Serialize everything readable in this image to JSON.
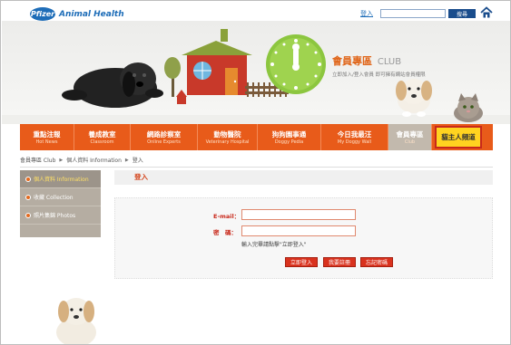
{
  "header": {
    "logo_mark": "Pfizer",
    "logo_text": "Animal Health",
    "login_link": "登入",
    "search_button": "搜尋"
  },
  "banner": {
    "club_title": "會員專區",
    "club_title_en": "CLUB",
    "club_subtitle": "立即加入/登入會員 即可擁有網站會員權限"
  },
  "nav": [
    {
      "zh": "重點注報",
      "en": "Hot News"
    },
    {
      "zh": "養成教室",
      "en": "Classroom"
    },
    {
      "zh": "網路診察室",
      "en": "Online Experts"
    },
    {
      "zh": "動物醫院",
      "en": "Veterinary Hospital"
    },
    {
      "zh": "狗狗園事通",
      "en": "Doggy Pedia"
    },
    {
      "zh": "今日我最汪",
      "en": "My Doggy Wall"
    },
    {
      "zh": "會員專區",
      "en": "Club"
    },
    {
      "zh": "貓主人頻道",
      "en": ""
    }
  ],
  "breadcrumb": {
    "c1": "會員專區 Club",
    "c2": "個人資料 Information",
    "c3": "登入"
  },
  "sidebar": [
    {
      "label": "個人資料 Information"
    },
    {
      "label": "收藏 Collection"
    },
    {
      "label": "照片集錦 Photos"
    }
  ],
  "main": {
    "title": "登入",
    "email_label": "E-mail：",
    "password_label": "密　碼：",
    "email_value": "",
    "password_value": "",
    "hint": "輸入完畢請點擊\"立即登入\"",
    "btn_login": "立即登入",
    "btn_register": "我要註冊",
    "btn_forgot": "忘記密碼"
  },
  "colors": {
    "nav_orange": "#e85b1a",
    "brand_blue": "#1e6db8",
    "accent_red": "#d9321e"
  }
}
